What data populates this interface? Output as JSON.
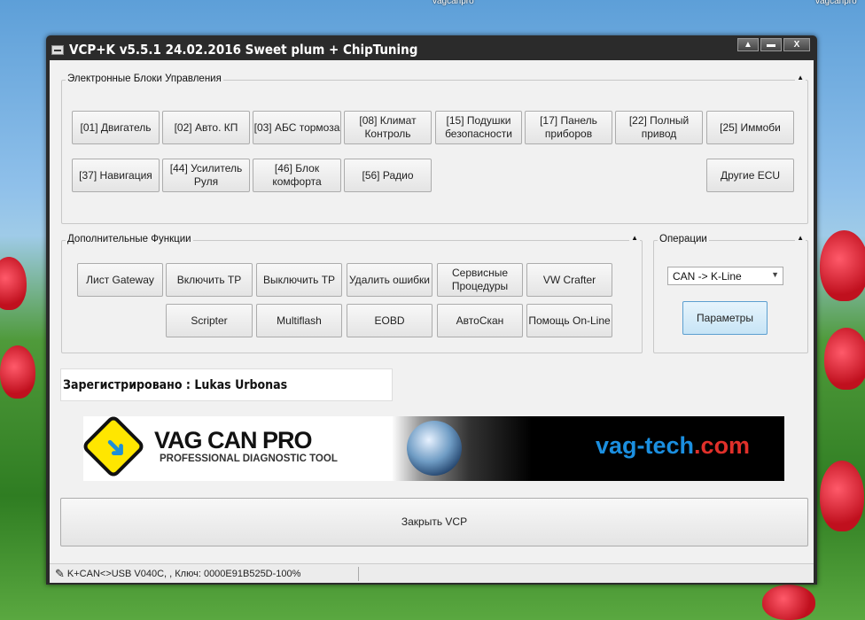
{
  "desktop": {
    "icon_labels": [
      "vagcanpro",
      "vagcanpro"
    ]
  },
  "window": {
    "title": "VCP+K v5.5.1 24.02.2016 Sweet plum + ChipTuning",
    "controls": [
      "▲",
      "▬",
      "X"
    ]
  },
  "ecu_group": {
    "label": "Электронные Блоки Управления",
    "buttons": [
      "[01] Двигатель",
      "[02] Авто. КП",
      "[03] АБС тормоза",
      "[08] Климат Контроль",
      "[15] Подушки безопасности",
      "[17] Панель приборов",
      "[22] Полный привод",
      "[25] Иммоби",
      "[37] Навигация",
      "[44] Усилитель Руля",
      "[46] Блок комфорта",
      "[56] Радио",
      "Другие ECU"
    ]
  },
  "functions_group": {
    "label": "Дополнительные Функции",
    "buttons": [
      "Лист Gateway",
      "Включить TP",
      "Выключить TP",
      "Удалить ошибки",
      "Сервисные Процедуры",
      "VW Crafter",
      "Scripter",
      "Multiflash",
      "EOBD",
      "АвтоСкан",
      "Помощь On-Line"
    ]
  },
  "operations_group": {
    "label": "Операции",
    "protocol_select": "CAN -> K-Line",
    "params_button": "Параметры"
  },
  "registration": "Зарегистрировано : Lukas Urbonas",
  "banner": {
    "title": "VAG CAN PRO",
    "subtitle": "PROFESSIONAL DIAGNOSTIC TOOL",
    "site_main": "vag-tech",
    "site_tld": ".com"
  },
  "close_button": "Закрыть VCP",
  "status": "K+CAN<>USB V040C, , Ключ: 0000E91B525D-100%"
}
